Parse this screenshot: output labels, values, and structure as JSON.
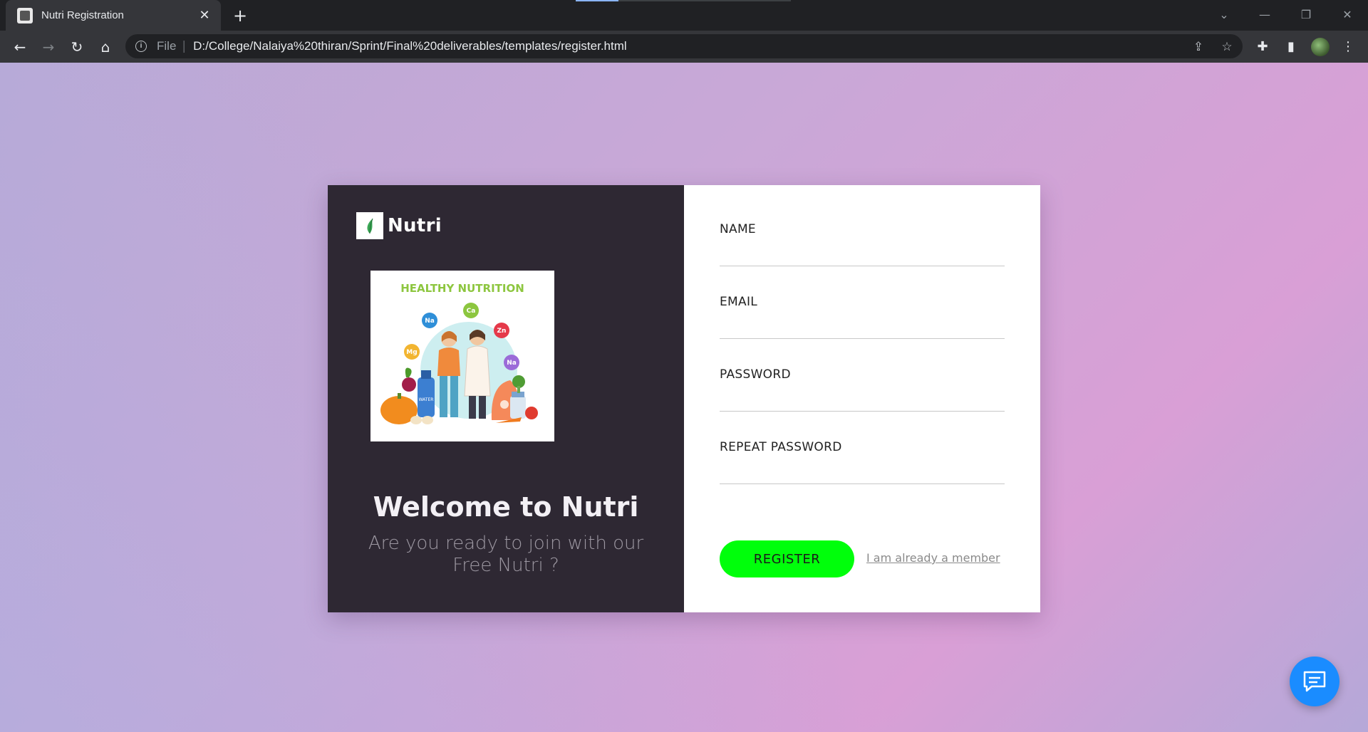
{
  "browser": {
    "tab_title": "Nutri Registration",
    "tab_close": "✕",
    "new_tab": "+",
    "url_scheme": "File",
    "url_separator": "|",
    "url": "D:/College/Nalaiya%20thiran/Sprint/Final%20deliverables/templates/register.html",
    "icons": [
      "back-icon",
      "forward-icon",
      "reload-icon",
      "home-icon",
      "info-icon",
      "share-icon",
      "star-icon",
      "extensions-icon",
      "side-panel-icon",
      "profile-avatar",
      "menu-icon"
    ]
  },
  "left_panel": {
    "brand_name": "Nutri",
    "illustration_title": "HEALTHY NUTRITION",
    "nutrient_badges": [
      "Na",
      "Ca",
      "Zn",
      "Mg",
      "Na"
    ],
    "water_label": "WATER",
    "welcome": "Welcome to Nutri",
    "tagline": "Are you ready to join with our Free Nutri ?"
  },
  "form": {
    "name_label": "NAME",
    "name_value": "",
    "email_label": "EMAIL",
    "email_value": "",
    "password_label": "PASSWORD",
    "password_value": "",
    "repeat_password_label": "REPEAT PASSWORD",
    "repeat_password_value": "",
    "register_label": "REGISTER",
    "member_link": "I am already a member"
  },
  "colors": {
    "panel_dark": "#2e2833",
    "register_button": "#00ff0b",
    "chat_button": "#1a8cff",
    "illustration_title": "#8dc63f"
  }
}
